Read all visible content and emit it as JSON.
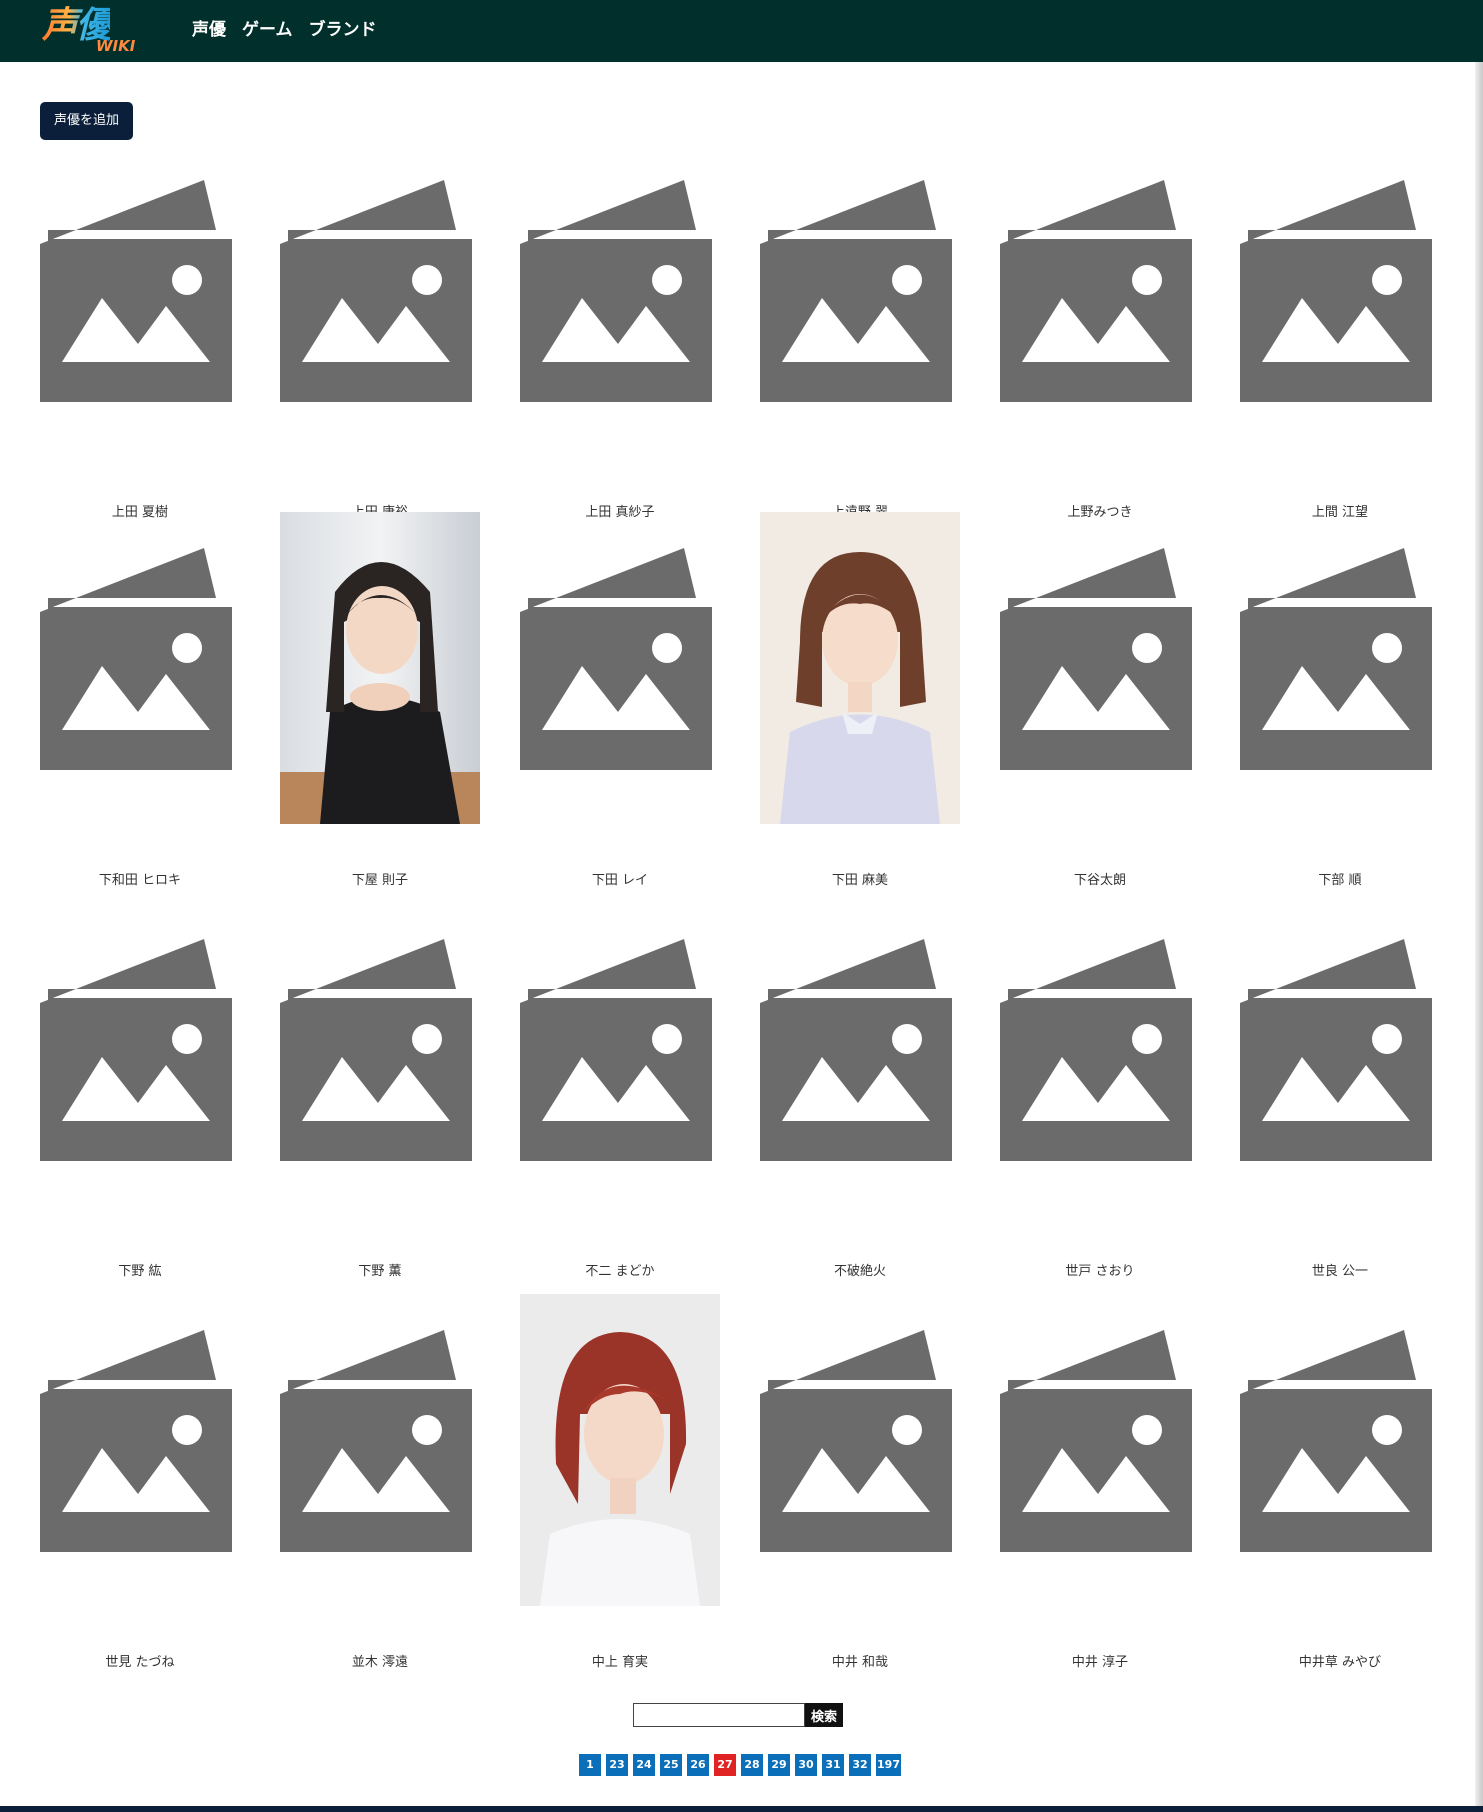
{
  "header": {
    "logo_text": "声優",
    "logo_sub": "WIKI",
    "nav": [
      "声優",
      "ゲーム",
      "ブランド"
    ]
  },
  "add_button_label": "声優を追加",
  "actors": [
    {
      "name": "上田 夏樹",
      "photo": "placeholder"
    },
    {
      "name": "上田 康裕",
      "photo": "placeholder"
    },
    {
      "name": "上田 真紗子",
      "photo": "placeholder"
    },
    {
      "name": "上遠野 翠",
      "photo": "placeholder"
    },
    {
      "name": "上野みつき",
      "photo": "placeholder"
    },
    {
      "name": "上間 江望",
      "photo": "placeholder"
    },
    {
      "name": "下和田 ヒロキ",
      "photo": "placeholder"
    },
    {
      "name": "下屋 則子",
      "photo": "portrait-dark-hair"
    },
    {
      "name": "下田 レイ",
      "photo": "placeholder"
    },
    {
      "name": "下田 麻美",
      "photo": "portrait-bob"
    },
    {
      "name": "下谷太朗",
      "photo": "placeholder"
    },
    {
      "name": "下部 順",
      "photo": "placeholder"
    },
    {
      "name": "下野 紘",
      "photo": "placeholder"
    },
    {
      "name": "下野 薫",
      "photo": "placeholder"
    },
    {
      "name": "不二 まどか",
      "photo": "placeholder"
    },
    {
      "name": "不破絶火",
      "photo": "placeholder"
    },
    {
      "name": "世戸 さおり",
      "photo": "placeholder"
    },
    {
      "name": "世良 公一",
      "photo": "placeholder"
    },
    {
      "name": "世見 たづね",
      "photo": "placeholder"
    },
    {
      "name": "並木 澪遠",
      "photo": "placeholder"
    },
    {
      "name": "中上 育実",
      "photo": "portrait-red-hair"
    },
    {
      "name": "中井 和哉",
      "photo": "placeholder"
    },
    {
      "name": "中井 淳子",
      "photo": "placeholder"
    },
    {
      "name": "中井草 みやび",
      "photo": "placeholder"
    }
  ],
  "search": {
    "button_label": "検索",
    "value": ""
  },
  "pagination": {
    "pages": [
      "1",
      "23",
      "24",
      "25",
      "26",
      "27",
      "28",
      "29",
      "30",
      "31",
      "32",
      "197"
    ],
    "current": "27"
  },
  "colors": {
    "header_bg": "#01302c",
    "add_button_bg": "#0b1f3a",
    "page_link_bg": "#0a6fb8",
    "page_current_bg": "#e02424",
    "placeholder_gray": "#6b6b6b"
  }
}
